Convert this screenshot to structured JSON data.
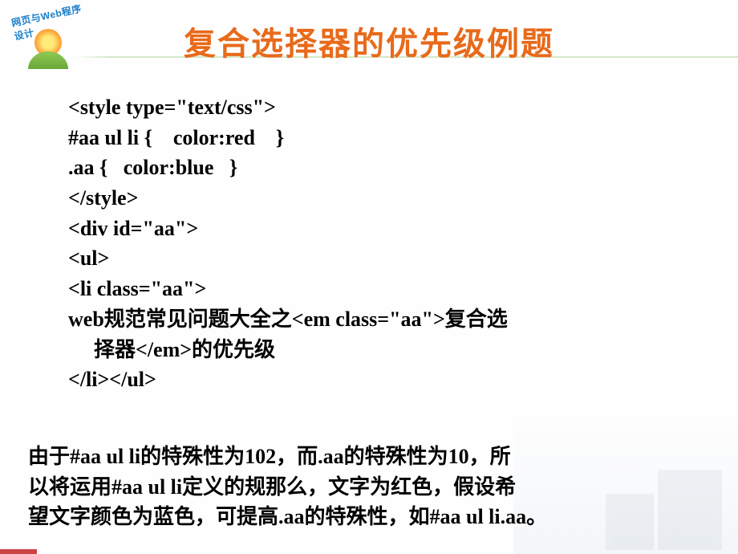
{
  "logo": {
    "text": "网页与Web程序设计"
  },
  "title": "复合选择器的优先级例题",
  "code": {
    "line1": "<style type=\"text/css\">",
    "line2": "#aa ul li {    color:red    }",
    "line3": ".aa {   color:blue   }",
    "line4": "</style>",
    "line5": "<div id=\"aa\">",
    "line6": "<ul>",
    "line7": "<li class=\"aa\">",
    "line8a": "web规范常见问题大全之<em class=\"aa\">复合选",
    "line8b": "择器</em>的优先级",
    "line9": "</li></ul>"
  },
  "explanation": {
    "line1": "由于#aa ul li的特殊性为102，而.aa的特殊性为10，所",
    "line2": "以将运用#aa ul li定义的规那么，文字为红色，假设希",
    "line3": "望文字颜色为蓝色，可提高.aa的特殊性，如#aa ul li.aa。"
  }
}
